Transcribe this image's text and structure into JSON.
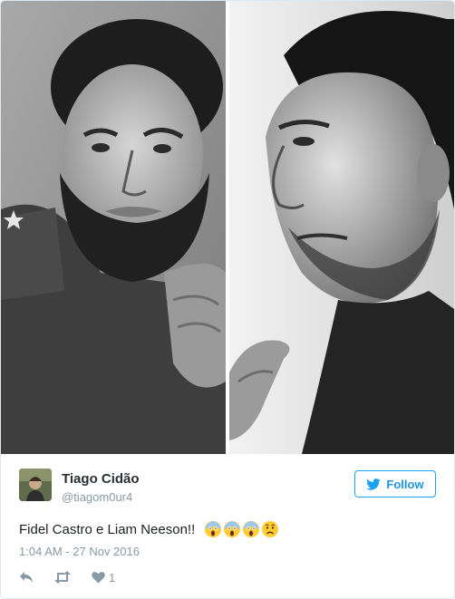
{
  "images": [
    {
      "alt": "",
      "subject": "left-portrait"
    },
    {
      "alt": "",
      "subject": "right-portrait"
    }
  ],
  "author": {
    "name": "Tiago Cidão",
    "handle": "@tiagom0ur4"
  },
  "follow_button": {
    "label": "Follow",
    "icon": "twitter-bird-icon",
    "color": "#1da1f2"
  },
  "tweet": {
    "text": "Fidel Castro e Liam Neeson!!",
    "emojis": [
      "scream-emoji",
      "scream-emoji",
      "scream-emoji",
      "worried-emoji"
    ],
    "timestamp": "1:04 AM - 27 Nov 2016"
  },
  "actions": {
    "reply_icon": "reply-icon",
    "retweet_icon": "retweet-icon",
    "like_icon": "heart-icon",
    "like_count": "1"
  }
}
